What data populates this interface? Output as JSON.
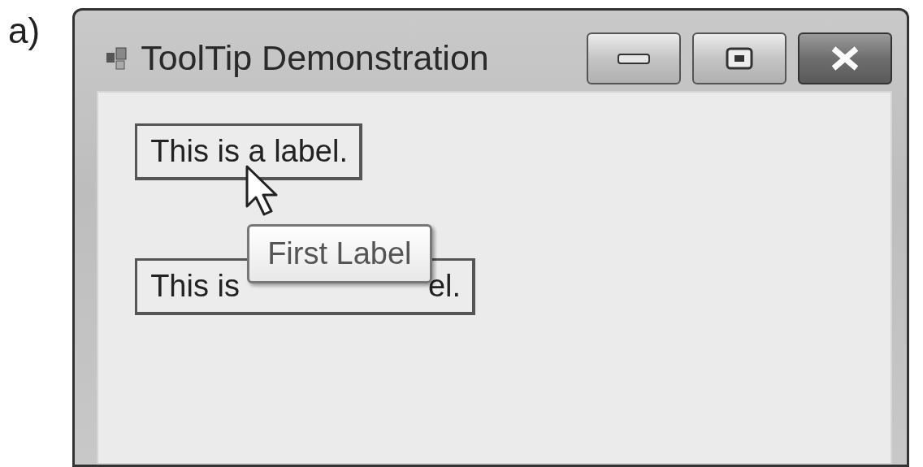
{
  "caption": "a)",
  "window": {
    "title": "ToolTip Demonstration",
    "buttons": [
      {
        "kind": "minimize"
      },
      {
        "kind": "maximize"
      },
      {
        "kind": "close"
      }
    ]
  },
  "labels": [
    {
      "text": "This is a label."
    },
    {
      "text": "This is",
      "text_after": "el."
    }
  ],
  "tooltip": {
    "text": "First Label"
  }
}
